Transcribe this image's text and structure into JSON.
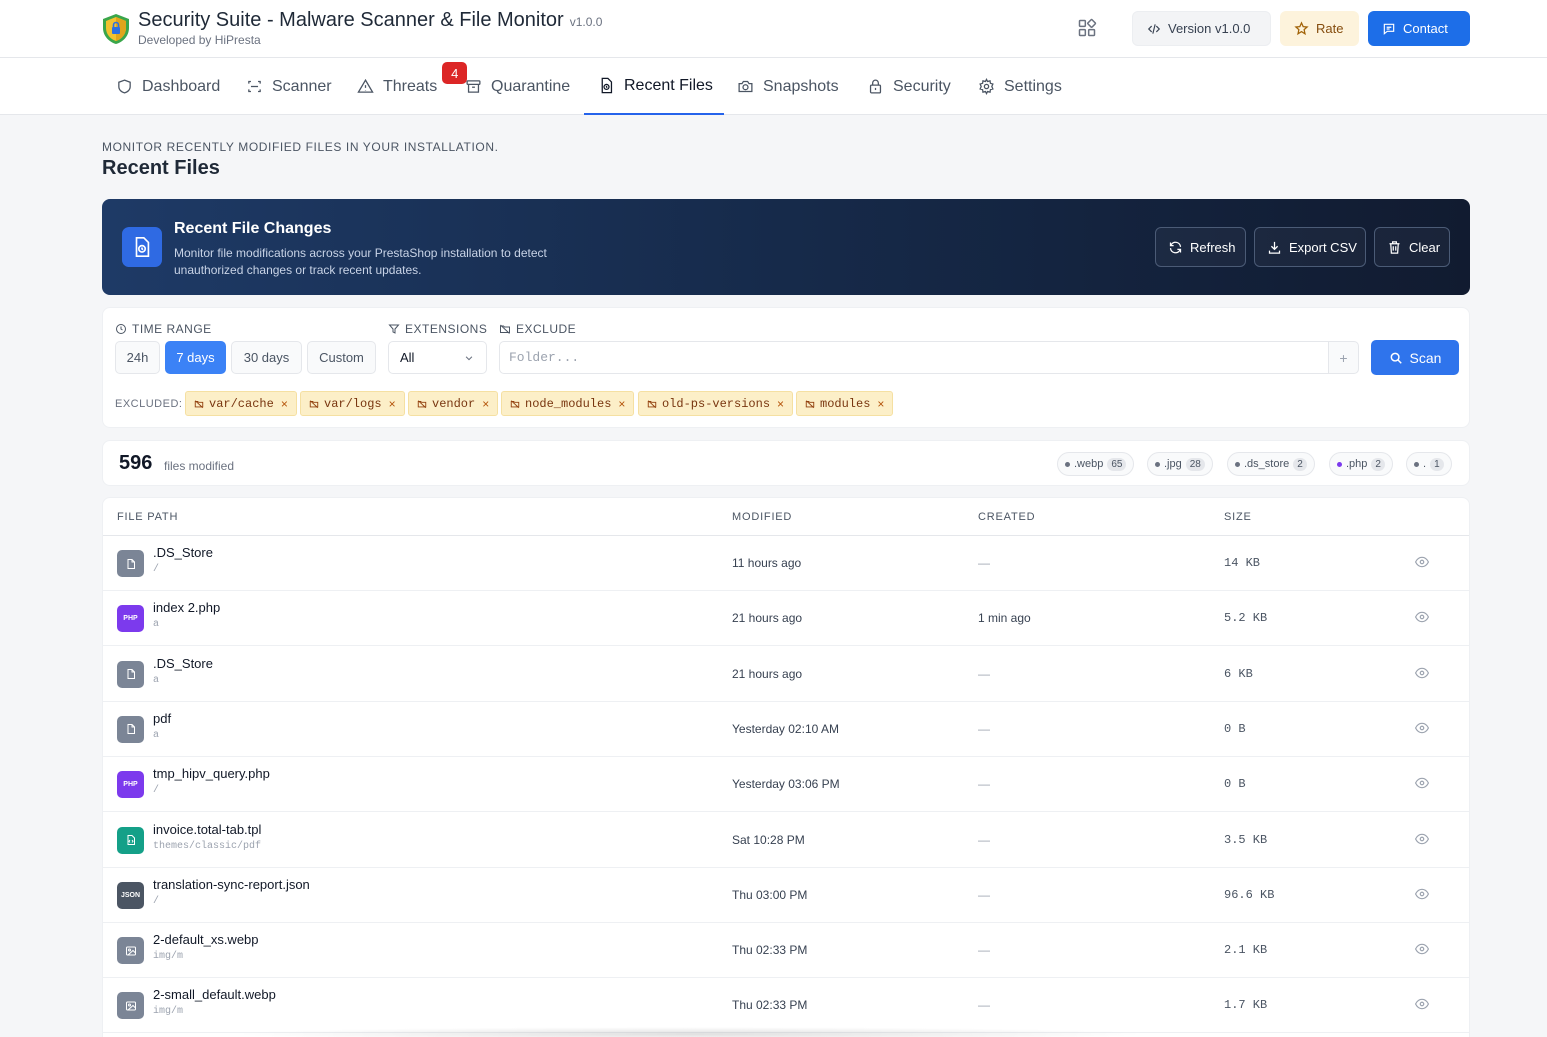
{
  "header": {
    "title": "Security Suite - Malware Scanner & File Monitor",
    "version_tag": "v1.0.0",
    "subtitle": "Developed by HiPresta",
    "buttons": {
      "version": "Version v1.0.0",
      "rate": "Rate",
      "contact": "Contact"
    }
  },
  "tabs": [
    {
      "label": "Dashboard",
      "icon": "shield-icon"
    },
    {
      "label": "Scanner",
      "icon": "scan-icon"
    },
    {
      "label": "Threats",
      "icon": "warning-icon",
      "badge": "4"
    },
    {
      "label": "Quarantine",
      "icon": "archive-icon"
    },
    {
      "label": "Recent Files",
      "icon": "file-clock-icon",
      "active": true
    },
    {
      "label": "Snapshots",
      "icon": "camera-icon"
    },
    {
      "label": "Security",
      "icon": "lock-icon"
    },
    {
      "label": "Settings",
      "icon": "gear-icon"
    }
  ],
  "page": {
    "subtitle": "Monitor recently modified files in your installation.",
    "title": "Recent Files"
  },
  "banner": {
    "title": "Recent File Changes",
    "description": "Monitor file modifications across your PrestaShop installation to detect unauthorized changes or track recent updates.",
    "buttons": {
      "refresh": "Refresh",
      "export": "Export CSV",
      "clear": "Clear"
    }
  },
  "filters": {
    "time_range_label": "TIME RANGE",
    "ranges": [
      "24h",
      "7 days",
      "30 days",
      "Custom"
    ],
    "active_range": "7 days",
    "extensions_label": "EXTENSIONS",
    "extensions_value": "All",
    "exclude_label": "EXCLUDE",
    "exclude_placeholder": "Folder...",
    "add_label": "+",
    "scan_label": "Scan",
    "excluded_label": "EXCLUDED:",
    "excluded": [
      "var/cache",
      "var/logs",
      "vendor",
      "node_modules",
      "old-ps-versions",
      "modules"
    ]
  },
  "summary": {
    "count": "596",
    "count_label": "files modified",
    "extensions": [
      {
        "ext": ".webp",
        "count": "65",
        "color": "#6b7280"
      },
      {
        "ext": ".jpg",
        "count": "28",
        "color": "#6b7280"
      },
      {
        "ext": ".ds_store",
        "count": "2",
        "color": "#6b7280"
      },
      {
        "ext": ".php",
        "count": "2",
        "color": "#7c3aed"
      },
      {
        "ext": ".",
        "count": "1",
        "color": "#6b7280"
      }
    ]
  },
  "table": {
    "columns": [
      "FILE PATH",
      "MODIFIED",
      "CREATED",
      "SIZE"
    ],
    "rows": [
      {
        "name": ".DS_Store",
        "dir": "/",
        "modified": "11 hours ago",
        "created": "—",
        "size": "14 KB",
        "type": "generic"
      },
      {
        "name": "index 2.php",
        "dir": "a",
        "modified": "21 hours ago",
        "created": "1 min ago",
        "size": "5.2 KB",
        "type": "php"
      },
      {
        "name": ".DS_Store",
        "dir": "a",
        "modified": "21 hours ago",
        "created": "—",
        "size": "6 KB",
        "type": "generic"
      },
      {
        "name": "pdf",
        "dir": "a",
        "modified": "Yesterday 02:10 AM",
        "created": "—",
        "size": "0 B",
        "type": "generic"
      },
      {
        "name": "tmp_hipv_query.php",
        "dir": "/",
        "modified": "Yesterday 03:06 PM",
        "created": "—",
        "size": "0 B",
        "type": "php"
      },
      {
        "name": "invoice.total-tab.tpl",
        "dir": "themes/classic/pdf",
        "modified": "Sat 10:28 PM",
        "created": "—",
        "size": "3.5 KB",
        "type": "tpl"
      },
      {
        "name": "translation-sync-report.json",
        "dir": "/",
        "modified": "Thu 03:00 PM",
        "created": "—",
        "size": "96.6 KB",
        "type": "json"
      },
      {
        "name": "2-default_xs.webp",
        "dir": "img/m",
        "modified": "Thu 02:33 PM",
        "created": "—",
        "size": "2.1 KB",
        "type": "image"
      },
      {
        "name": "2-small_default.webp",
        "dir": "img/m",
        "modified": "Thu 02:33 PM",
        "created": "—",
        "size": "1.7 KB",
        "type": "image"
      }
    ]
  },
  "colors": {
    "accent": "#2f74ec",
    "banner_start": "#1e3a66",
    "banner_end": "#111b30",
    "threat_badge": "#dc2626",
    "chip_bg": "#fcefc8"
  }
}
